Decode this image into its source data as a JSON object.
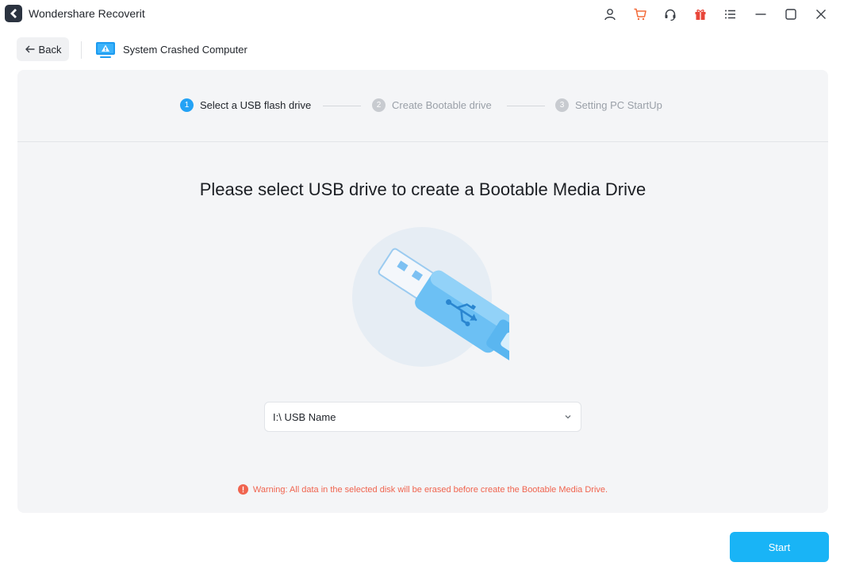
{
  "window": {
    "title": "Wondershare Recoverit",
    "toolbar_icons": [
      "user-icon",
      "cart-icon",
      "headset-icon",
      "gift-icon",
      "menu-icon",
      "minimize-icon",
      "maximize-icon",
      "close-icon"
    ]
  },
  "nav": {
    "back_label": "Back",
    "breadcrumb_label": "System Crashed Computer"
  },
  "steps": [
    {
      "number": "1",
      "label": "Select a USB flash drive",
      "state": "active"
    },
    {
      "number": "2",
      "label": "Create Bootable drive",
      "state": "inactive"
    },
    {
      "number": "3",
      "label": "Setting PC StartUp",
      "state": "inactive"
    }
  ],
  "main": {
    "headline": "Please select USB drive to create a Bootable Media Drive",
    "usb_select_value": "I:\\ USB Name",
    "warning_text": "Warning: All data in the selected disk will be erased before create the Bootable Media Drive."
  },
  "footer": {
    "start_label": "Start"
  },
  "colors": {
    "accent": "#19b4f6",
    "step_active": "#23a2f5",
    "warning": "#f0644f",
    "cart": "#f26b3a",
    "gift": "#e8463a"
  }
}
